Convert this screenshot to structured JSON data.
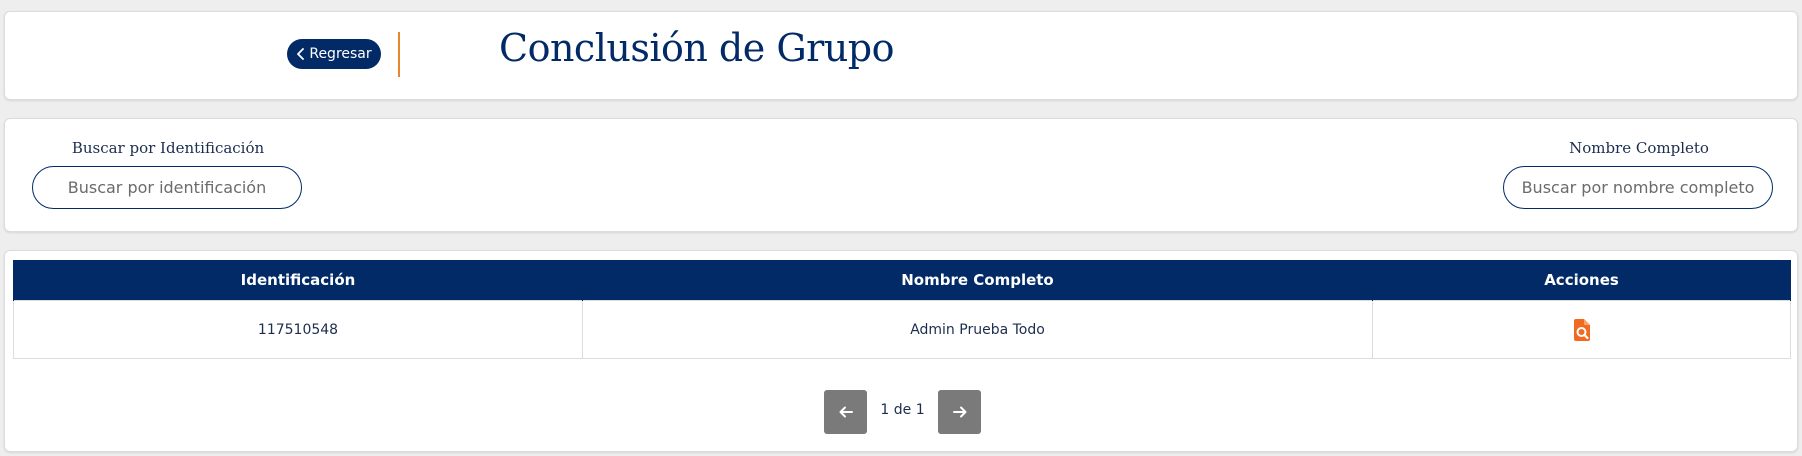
{
  "header": {
    "back_label": "Regresar",
    "title": "Conclusión de Grupo"
  },
  "filters": {
    "id_label": "Buscar por Identificación",
    "id_placeholder": "Buscar por identificación",
    "id_value": "",
    "name_label": "Nombre Completo",
    "name_placeholder": "Buscar por nombre completo",
    "name_value": ""
  },
  "table": {
    "columns": [
      "Identificación",
      "Nombre Completo",
      "Acciones"
    ],
    "rows": [
      {
        "identificacion": "117510548",
        "nombre_completo": "Admin Prueba Todo",
        "action_icon": "document-search-icon"
      }
    ]
  },
  "pagination": {
    "text": "1 de 1",
    "prev_icon": "arrow-left-icon",
    "next_icon": "arrow-right-icon"
  },
  "colors": {
    "brand_navy": "#012a66",
    "accent_orange": "#e8862b",
    "action_orange": "#f06a1f",
    "pager_gray": "#7a7a7a"
  }
}
